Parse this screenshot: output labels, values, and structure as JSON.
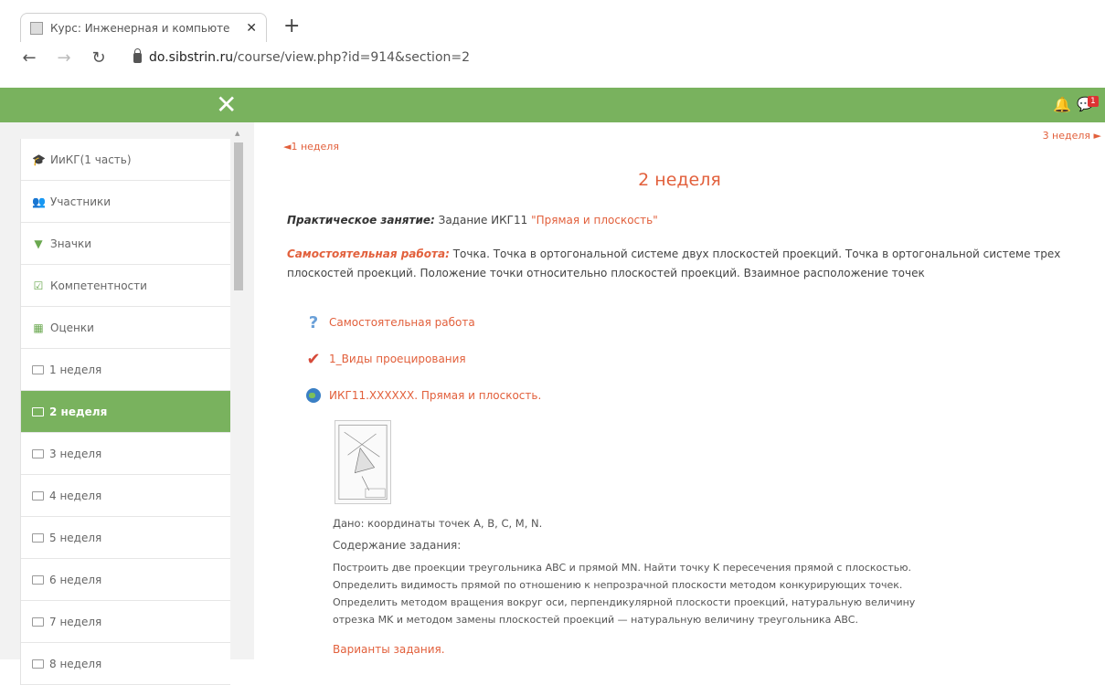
{
  "browser": {
    "tab_title": "Курс: Инженерная и компьюте",
    "tab_close": "✕",
    "new_tab": "+",
    "url_host": "do.sibstrin.ru",
    "url_path": "/course/view.php?id=914&section=2"
  },
  "header": {
    "close_icon": "✕",
    "notifications_badge": "1"
  },
  "sidebar": {
    "items": [
      {
        "label": "ИиКГ(1 часть)",
        "icon": "graduation-cap-icon",
        "glyph": "🎓"
      },
      {
        "label": "Участники",
        "icon": "users-icon",
        "glyph": "👥"
      },
      {
        "label": "Значки",
        "icon": "shield-icon",
        "glyph": "▼"
      },
      {
        "label": "Компетентности",
        "icon": "checkbox-icon",
        "glyph": "☑"
      },
      {
        "label": "Оценки",
        "icon": "table-icon",
        "glyph": "▦"
      },
      {
        "label": "1 неделя",
        "icon": "folder-icon"
      },
      {
        "label": "2 неделя",
        "icon": "folder-icon",
        "active": true
      },
      {
        "label": "3 неделя",
        "icon": "folder-icon"
      },
      {
        "label": "4 неделя",
        "icon": "folder-icon"
      },
      {
        "label": "5 неделя",
        "icon": "folder-icon"
      },
      {
        "label": "6 неделя",
        "icon": "folder-icon"
      },
      {
        "label": "7 неделя",
        "icon": "folder-icon"
      },
      {
        "label": "8 неделя",
        "icon": "folder-icon"
      }
    ]
  },
  "main": {
    "prev_link": "◄1 неделя",
    "next_link": "3 неделя ►",
    "section_title": "2 неделя",
    "practice_label": "Практическое занятие:",
    "practice_text": " Задание ИКГ11 ",
    "practice_link": "\"Прямая и плоскость\"",
    "selfwork_label": "Самостоятельная работа:",
    "selfwork_text": " Точка. Точка в ортогональной системе двух плоскостей проекций. Точка в ортогональной системе трех плоскостей проекций. Положение точки относительно плоскостей проекций. Взаимное расположение точек",
    "activities": [
      {
        "label": "Самостоятельная работа",
        "icon": "quiz-icon"
      },
      {
        "label": "1_Виды проецирования",
        "icon": "assignment-icon"
      },
      {
        "label": "ИКГ11.XXXXXX. Прямая и плоскость.",
        "icon": "resource-icon"
      }
    ],
    "given": "Дано: координаты точек A, B, C, M, N.",
    "task_heading": "Содержание задания:",
    "task_lines": [
      "Построить две проекции треугольника ABC и прямой MN. Найти точку K пересечения прямой с плоскостью.",
      "Определить видимость прямой по отношению к непрозрачной плоскости методом конкурирующих точек.",
      "Определить методом вращения вокруг оси, перпендикулярной плоскости проекций, натуральную величину",
      "отрезка MK и методом замены плоскостей проекций — натуральную величину треугольника ABC."
    ],
    "variants_link": "Варианты задания."
  },
  "colors": {
    "accent_green": "#79b25e",
    "link_orange": "#e2603c"
  }
}
